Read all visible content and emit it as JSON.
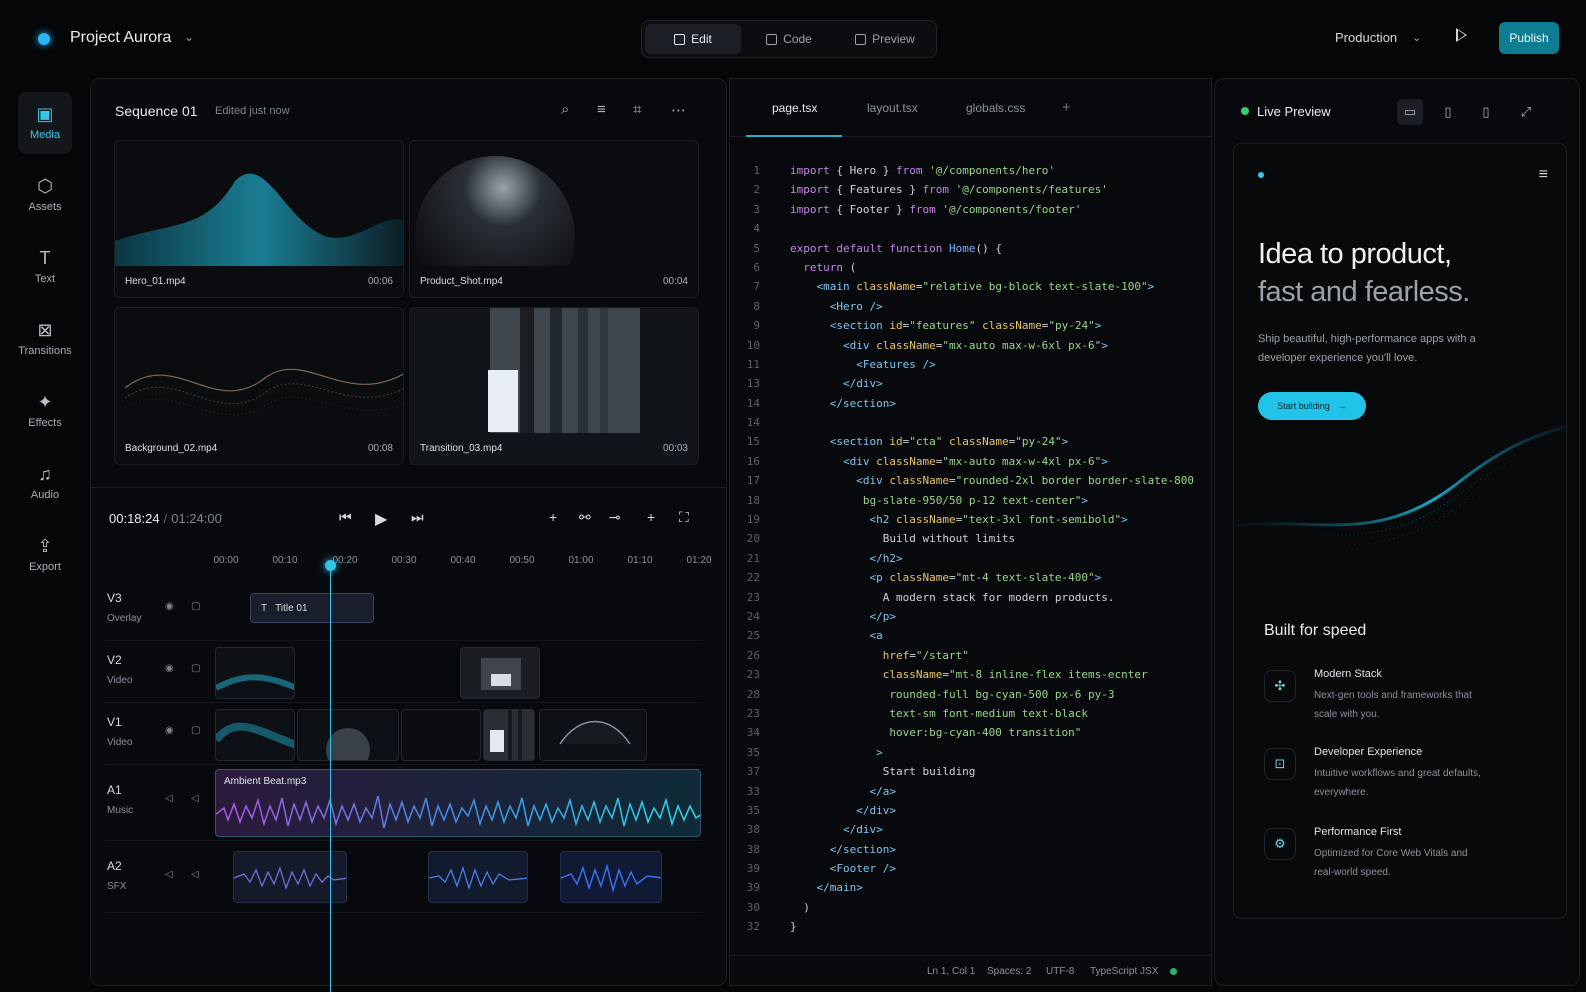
{
  "app": {
    "title": "Project Aurora"
  },
  "modes": [
    {
      "label": "Edit",
      "active": true
    },
    {
      "label": "Code",
      "active": false
    },
    {
      "label": "Preview",
      "active": false
    }
  ],
  "header": {
    "environment": "Production",
    "publish_label": "Publish"
  },
  "rail": [
    {
      "label": "Media",
      "icon": "media-icon",
      "active": true
    },
    {
      "label": "Assets",
      "icon": "assets-icon"
    },
    {
      "label": "Text",
      "icon": "text-icon"
    },
    {
      "label": "Transitions",
      "icon": "transitions-icon"
    },
    {
      "label": "Effects",
      "icon": "effects-icon"
    },
    {
      "label": "Audio",
      "icon": "audio-icon"
    },
    {
      "label": "Export",
      "icon": "export-icon"
    }
  ],
  "media": {
    "title": "Sequence 01",
    "subtitle": "Edited just now",
    "items": [
      {
        "name": "Hero_01.mp4",
        "duration": "00:06"
      },
      {
        "name": "Product_Shot.mp4",
        "duration": "00:04"
      },
      {
        "name": "Background_02.mp4",
        "duration": "00:08"
      },
      {
        "name": "Transition_03.mp4",
        "duration": "00:03"
      }
    ]
  },
  "timeline": {
    "current": "00:18:24",
    "separator": "/",
    "total": "01:24:00",
    "ruler": [
      "00:00",
      "00:10",
      "00:20",
      "00:30",
      "00:40",
      "00:50",
      "01:00",
      "01:10",
      "01:20"
    ],
    "tracks": [
      {
        "id": "V3",
        "kind": "Overlay"
      },
      {
        "id": "V2",
        "kind": "Video"
      },
      {
        "id": "V1",
        "kind": "Video"
      },
      {
        "id": "A1",
        "kind": "Music"
      },
      {
        "id": "A2",
        "kind": "SFX"
      }
    ],
    "title_clip": "Title 01",
    "audio_clip": "Ambient Beat.mp3"
  },
  "editor": {
    "tabs": [
      "page.tsx",
      "layout.tsx",
      "globals.css"
    ],
    "line_numbers": [
      "1",
      "2",
      "3",
      "4",
      "5",
      "6",
      "7",
      "8",
      "9",
      "10",
      "11",
      "13",
      "14",
      "14",
      "15",
      "16",
      "17",
      "18",
      "19",
      "20",
      "21",
      "22",
      "23",
      "24",
      "25",
      "26",
      "23",
      "28",
      "23",
      "34",
      "35",
      "37",
      "33",
      "35",
      "38",
      "38",
      "39",
      "39",
      "30",
      "32"
    ],
    "status": {
      "position": "Ln 1, Col 1",
      "spaces": "Spaces: 2",
      "encoding": "UTF-8",
      "language": "TypeScript JSX"
    }
  },
  "preview": {
    "label": "Live Preview",
    "hero_line1": "Idea to product,",
    "hero_line2": "fast and fearless.",
    "hero_sub": "Ship beautiful, high-performance apps with a developer experience you'll love.",
    "cta": "Start building",
    "section_title": "Built for speed",
    "features": [
      {
        "title": "Modern Stack",
        "desc": "Next-gen tools and frameworks that scale with you."
      },
      {
        "title": "Developer Experience",
        "desc": "Intuitive workflows and great defaults, everywhere."
      },
      {
        "title": "Performance First",
        "desc": "Optimized for Core Web Vitals and real-world speed."
      }
    ]
  }
}
